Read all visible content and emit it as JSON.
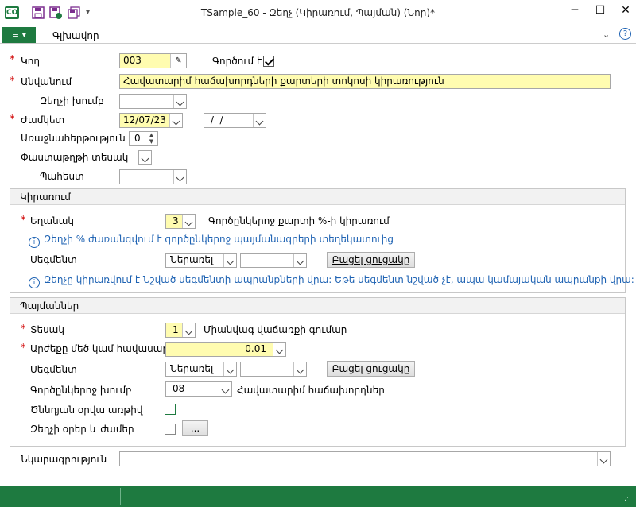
{
  "window": {
    "title": "TSample_60 - Զեղչ (Կիրառում, Պայման) (Նոր)*",
    "logo_text": "CO",
    "quick_access": [
      "save-icon",
      "save-close-icon",
      "save-copy-icon",
      "customize-icon"
    ],
    "buttons": [
      "minimize",
      "maximize",
      "close"
    ]
  },
  "ribbon": {
    "file_label": "≡",
    "home_tab": "Գլխավոր"
  },
  "form": {
    "code": {
      "label": "Կոդ",
      "value": "003"
    },
    "active": {
      "label": "Գործում է",
      "checked": true
    },
    "name": {
      "label": "Անվանում",
      "value": "Հավատարիմ հաճախորդների քարտերի տոկոսի կիրառություն"
    },
    "discount_group": {
      "label": "Զեղչի խումբ",
      "value": ""
    },
    "period": {
      "label": "Ժամկետ",
      "from": "12/07/23",
      "to": " /  / "
    },
    "priority": {
      "label": "Առաջնահերթություն",
      "value": "0"
    },
    "doc_type": {
      "label": "Փաստաթղթի տեսակ",
      "value": ""
    },
    "warehouse": {
      "label": "Պահեստ",
      "value": ""
    }
  },
  "apply": {
    "header": "Կիրառում",
    "method_label": "Եղանակ",
    "method_value": "3",
    "method_text": "Գործընկերոջ քարտի %-ի  կիրառում",
    "info1": "Զեղչի % ժառանգվում է գործընկերոջ պայմանագրերի տեղեկատուից",
    "segment_label": "Սեգմենտ",
    "segment_value": "Ներառել",
    "open_list": "Բացել ցուցակը",
    "info2": "Զեղչը կիրառվում է Նշված սեգմենտի ապրանքների վրա: Եթե սեգմենտ նշված չէ, ապա կամայական ապրանքի վրա:"
  },
  "conditions": {
    "header": "Պայմաններ",
    "type_label": "Տեսակ",
    "type_value": "1",
    "type_text": "Միանվագ վաճառքի գումար",
    "amount_label": "Արժեքը մեծ կամ հավասար է",
    "amount_value": "0.01",
    "segment_label": "Սեգմենտ",
    "segment_value": "Ներառել",
    "open_list": "Բացել ցուցակը",
    "partner_group_label": "Գործընկերոջ խումբ",
    "partner_group_value": "08",
    "partner_group_text": "Հավատարիմ հաճախորդներ",
    "birthday_label": "Ծննդյան օրվա առթիվ",
    "birthday_checked": false,
    "days_label": "Զեղչի օրեր և ժամեր",
    "days_checked": false,
    "days_button": "..."
  },
  "note": {
    "label": "Նկարագրություն",
    "value": ""
  },
  "colors": {
    "accent": "#1e7a40",
    "required": "#d00000",
    "info": "#1f63b3",
    "highlight": "#fffcb0"
  }
}
